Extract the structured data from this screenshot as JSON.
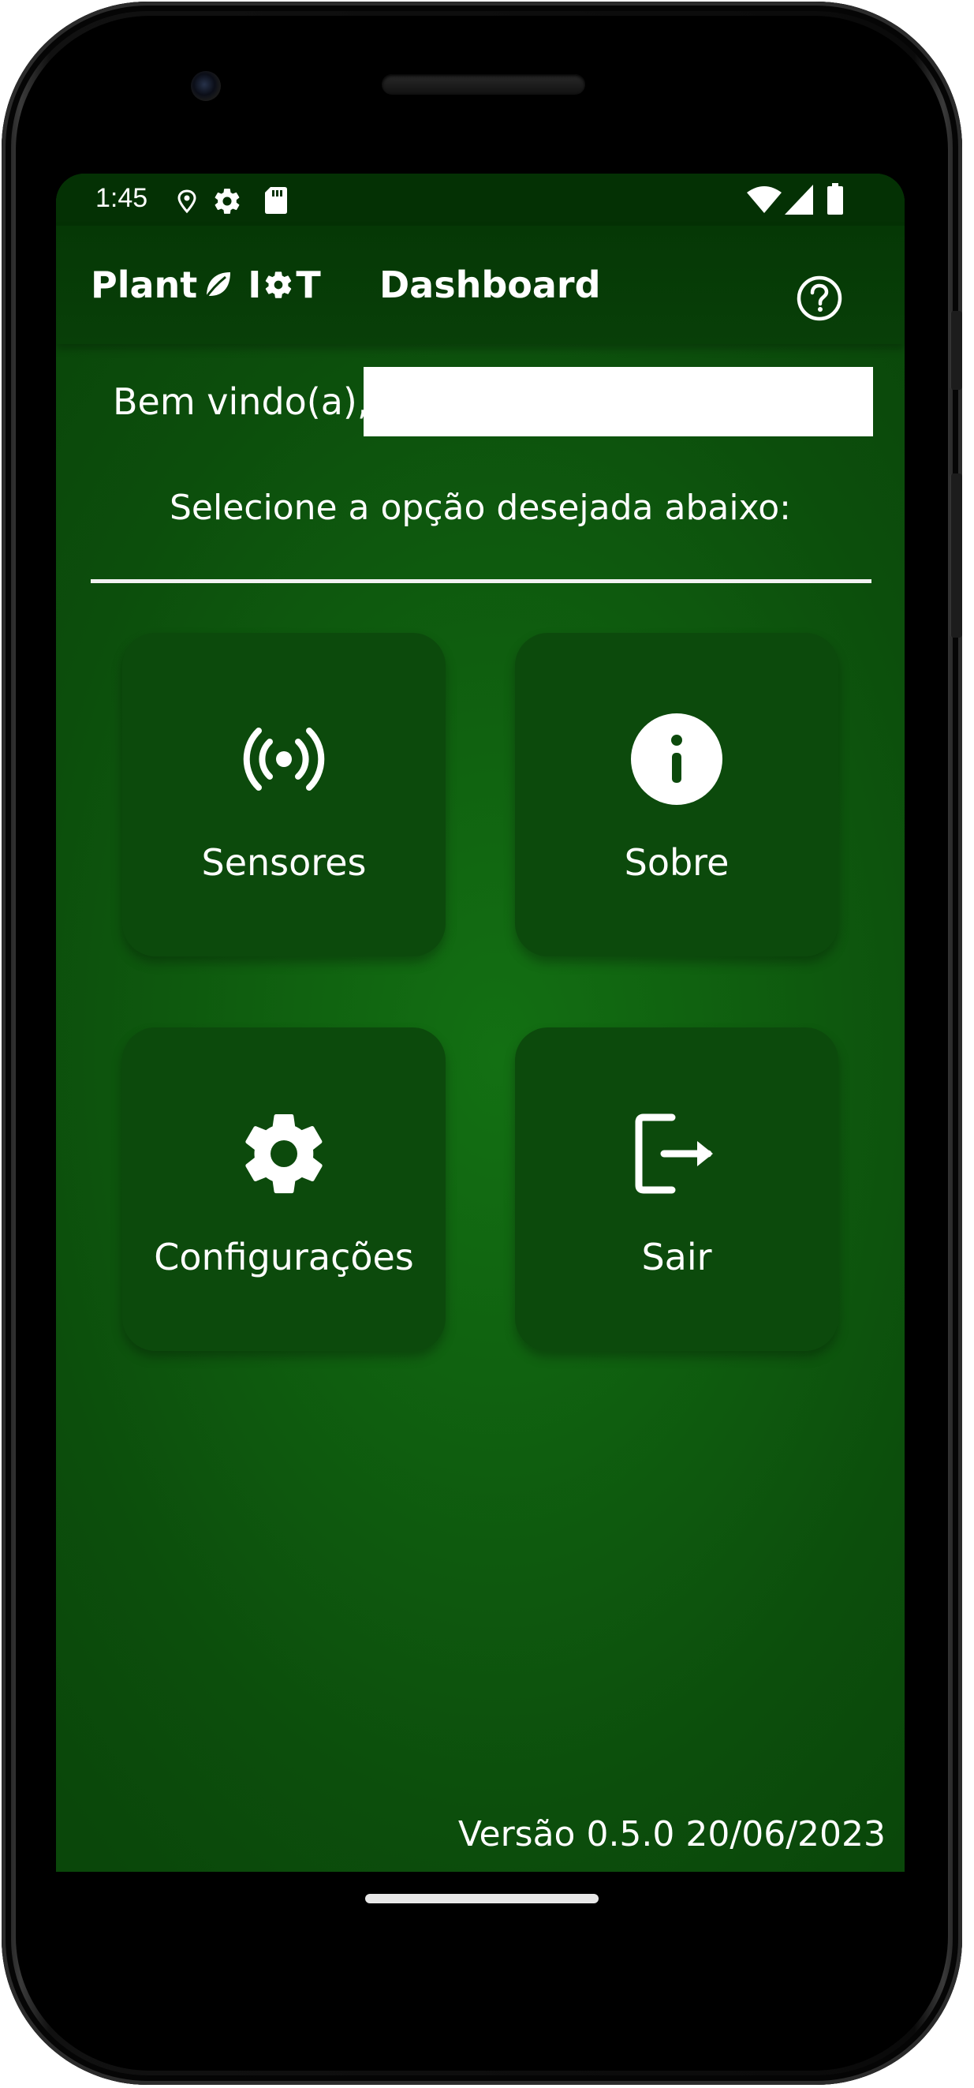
{
  "status_bar": {
    "time": "1:45",
    "left_icons": [
      "location-pin-icon",
      "settings-gear-icon",
      "sd-card-icon"
    ],
    "right_icons": [
      "wifi-icon",
      "cell-signal-icon",
      "battery-icon"
    ]
  },
  "app_bar": {
    "brand_word": "Plant",
    "brand_i": "I",
    "brand_t": "T",
    "title": "Dashboard",
    "help_icon": "help-circle-icon"
  },
  "welcome": {
    "greeting": "Bem vindo(a),",
    "name_value": ""
  },
  "instructions": "Selecione a opção desejada abaixo:",
  "menu": [
    {
      "label": "Sensores",
      "icon": "wireless-sensor-icon"
    },
    {
      "label": "Sobre",
      "icon": "info-icon"
    },
    {
      "label": "Configurações",
      "icon": "gear-icon"
    },
    {
      "label": "Sair",
      "icon": "logout-icon"
    }
  ],
  "version": "Versão 0.5.0 20/06/2023",
  "colors": {
    "status_bar": "#043104",
    "app_bar": "#063a06",
    "background": "#0f5e0f",
    "card": "#0c4a0c",
    "text": "#ffffff"
  }
}
